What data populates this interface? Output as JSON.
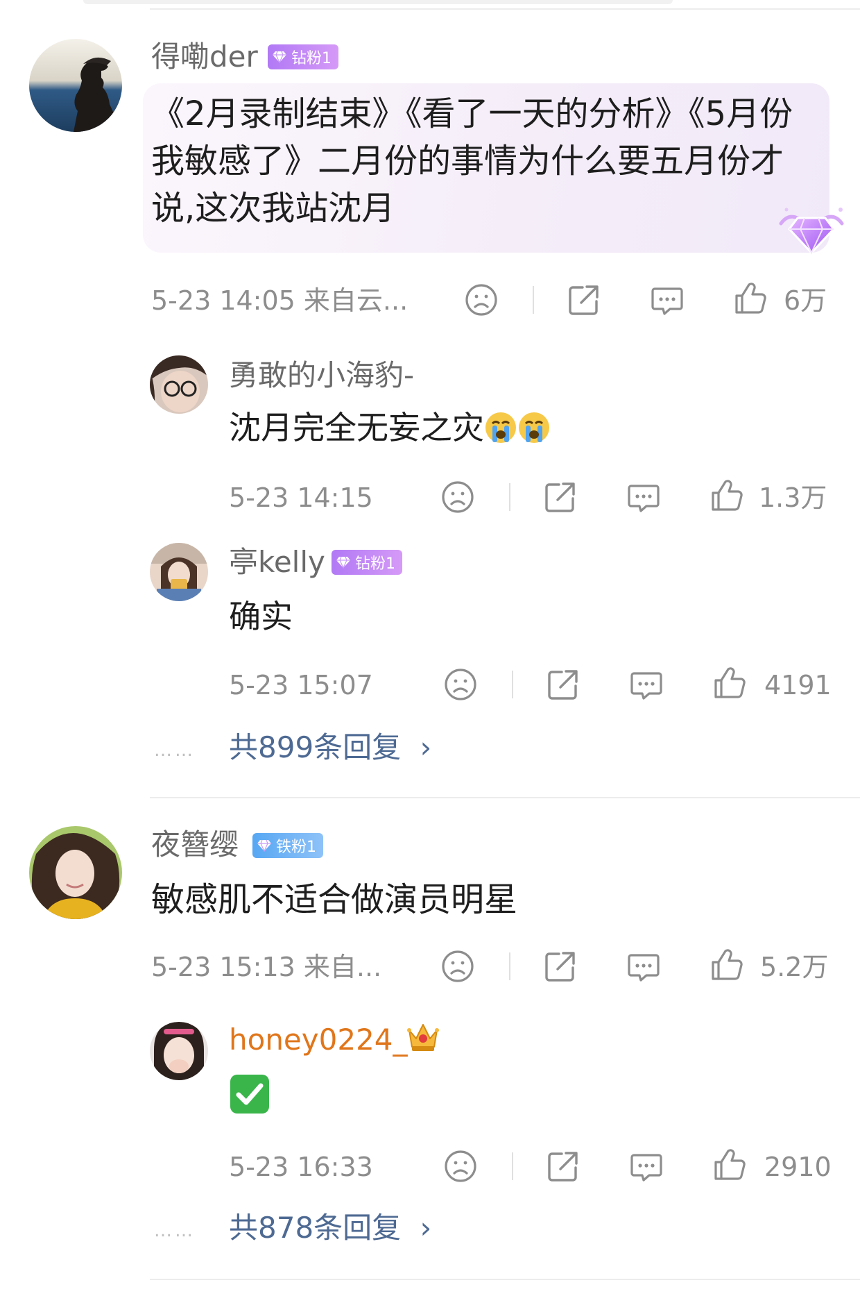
{
  "comments": [
    {
      "username": "得嘞der",
      "badge": "钻粉1",
      "text": "《2月录制结束》《看了一天的分析》《5月份我敏感了》二月份的事情为什么要五月份才说,这次我站沈月",
      "time": "5-23 14:05 来自云...",
      "likes": "6万",
      "replies": [
        {
          "username": "勇敢的小海豹-",
          "text": "沈月完全无妄之灾",
          "emoji": "crying-face",
          "time": "5-23 14:15",
          "likes": "1.3万"
        },
        {
          "username": "亭kelly",
          "badge": "钻粉1",
          "text": "确实",
          "time": "5-23 15:07",
          "likes": "4191"
        }
      ],
      "more_replies": "共899条回复"
    },
    {
      "username": "夜簪缨",
      "badge": "铁粉1",
      "text": "敏感肌不适合做演员明星",
      "time": "5-23 15:13 来自...",
      "likes": "5.2万",
      "replies": [
        {
          "username": "honey0224_",
          "text": "✅",
          "time": "5-23 16:33",
          "likes": "2910"
        }
      ],
      "more_replies": "共878条回复"
    }
  ],
  "ui": {
    "more_dots": "……",
    "chevron": "›"
  },
  "colors": {
    "badge_purple": "#b179f5",
    "badge_blue": "#57a7f3",
    "link_blue": "#4e6a93",
    "vip_orange": "#e0761b"
  },
  "icons": [
    "sad-face-icon",
    "share-icon",
    "comment-icon",
    "thumbs-up-icon",
    "diamond-icon",
    "crown-icon"
  ]
}
